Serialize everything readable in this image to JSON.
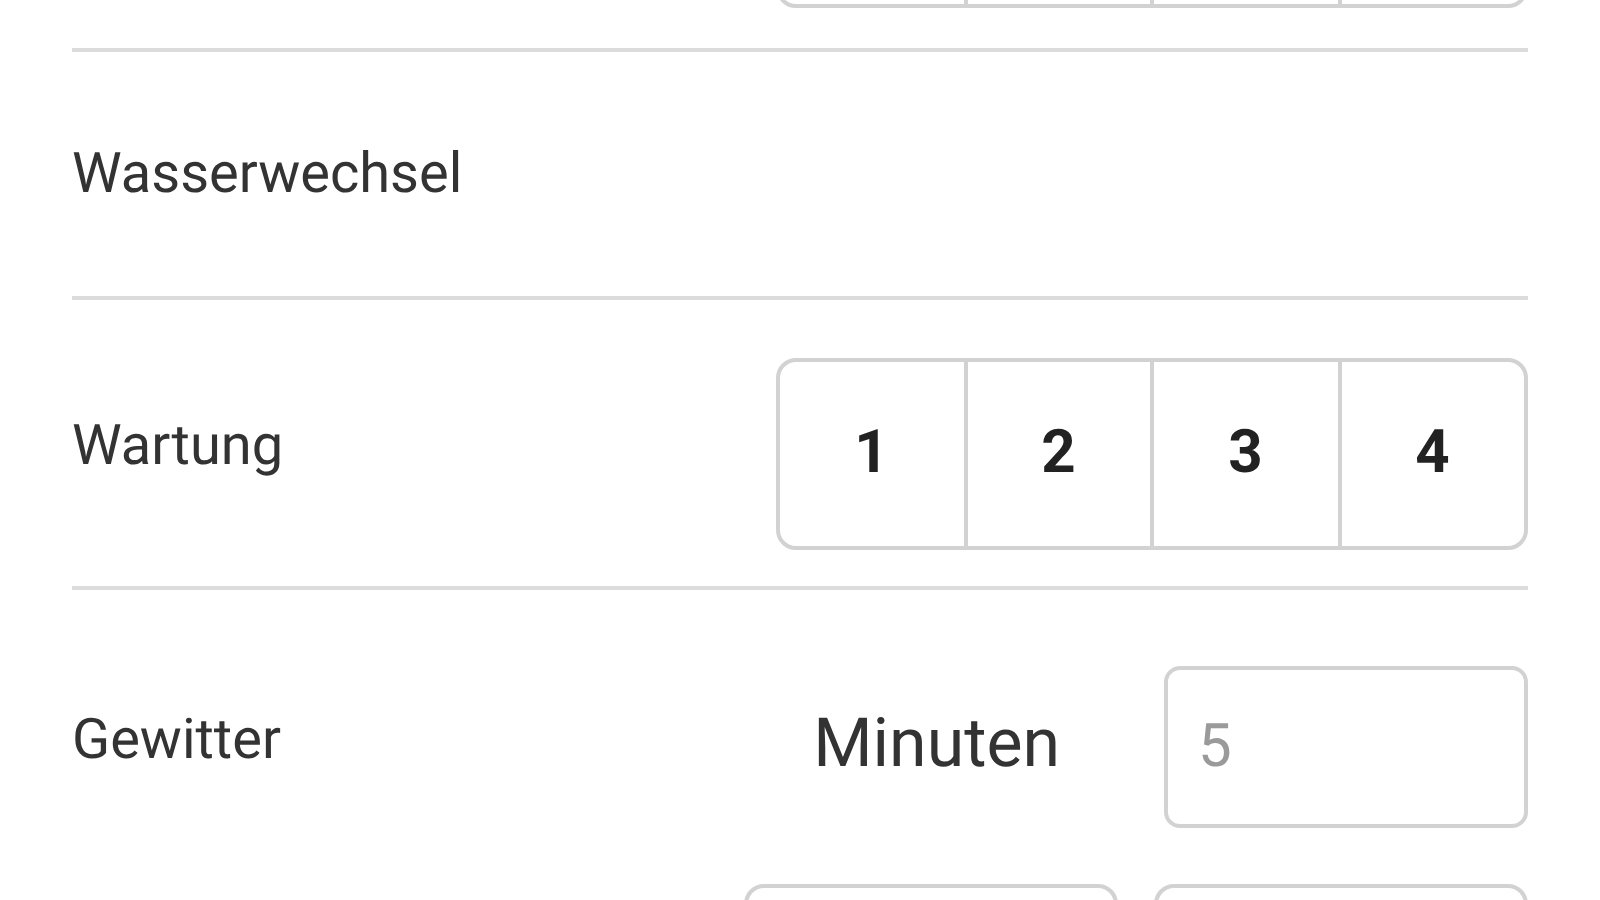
{
  "rows": [
    {
      "kind": "segments",
      "segments": [
        {
          "kind": "blank"
        },
        {
          "kind": "blank"
        },
        {
          "kind": "blank"
        },
        {
          "kind": "blank"
        }
      ]
    },
    {
      "kind": "plain",
      "label": "Wasserwechsel"
    },
    {
      "kind": "segments",
      "label": "Wartung",
      "segments": [
        {
          "kind": "number",
          "label": "1"
        },
        {
          "kind": "number",
          "label": "2"
        },
        {
          "kind": "number",
          "label": "3"
        },
        {
          "kind": "number",
          "label": "4"
        }
      ]
    },
    {
      "kind": "minutes",
      "label": "Gewitter",
      "unit": "Minuten",
      "placeholder": "5"
    },
    {
      "kind": "buttons",
      "buttons": [
        {
          "kind": "blank"
        },
        {
          "kind": "blank"
        }
      ]
    }
  ]
}
